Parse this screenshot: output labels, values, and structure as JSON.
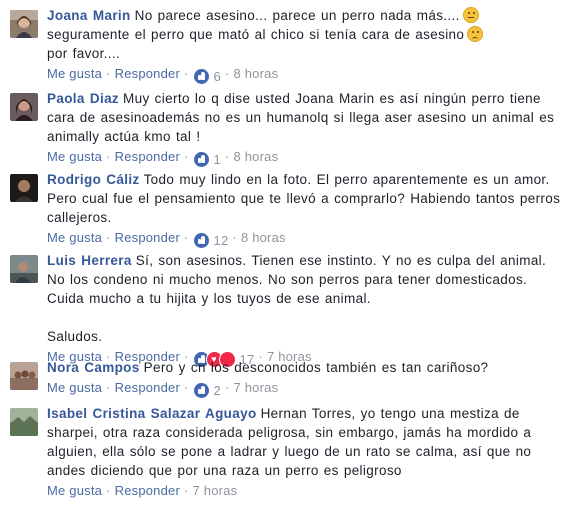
{
  "labels": {
    "like": "Me gusta",
    "reply": "Responder",
    "sep": "·"
  },
  "comments": [
    {
      "author": "Joana Marin",
      "text": "No parece asesino... parece un perro nada más....",
      "text2": " seguramente el perro que mató al chico si tenía cara de asesino",
      "text3": " por favor....",
      "reactions": "6",
      "time": "8 horas",
      "avatar_icon": "avatar-woman-photo"
    },
    {
      "author": "Paola Diaz",
      "text": "Muy cierto lo q dise usted Joana Marin es así ningún perro tiene cara de asesinoademás no es un humanolq si llega aser asesino un animal es animally actúa kmo tal !",
      "reactions": "1",
      "time": "8 horas",
      "avatar_icon": "avatar-woman-photo"
    },
    {
      "author": "Rodrigo Cáliz",
      "text": "Todo muy lindo en la foto. El perro aparentemente es un amor. Pero cual fue el pensamiento que te llevó a comprarlo? Habiendo tantos perros callejeros.",
      "reactions": "12",
      "time": "8 horas",
      "avatar_icon": "avatar-man-photo"
    },
    {
      "author": "Luis Herrera",
      "text": "Sí, son asesinos. Tienen ese instinto. Y no es culpa del animal. No los condeno ni mucho menos. No son perros para tener domesticados. Cuida mucho a tu hijita y los tuyos de ese animal.",
      "text_extra": "Saludos.",
      "reactions": "17",
      "time": "7 horas",
      "avatar_icon": "avatar-man-photo"
    },
    {
      "author": "Nora Campos",
      "text": "Pero y cn los desconocidos también es tan cariñoso?",
      "reactions": "2",
      "time": "7 horas",
      "avatar_icon": "avatar-group-photo"
    },
    {
      "author": "Isabel Cristina Salazar Aguayo",
      "text": "Hernan Torres, yo tengo una mestiza de sharpei, otra raza considerada peligrosa, sin embargo, jamás ha mordido a alguien, ella sólo se pone a ladrar y luego de un rato se calma, así que no andes diciendo que por una raza un perro es peligroso",
      "time": "7 horas",
      "avatar_icon": "avatar-landscape-photo"
    }
  ]
}
